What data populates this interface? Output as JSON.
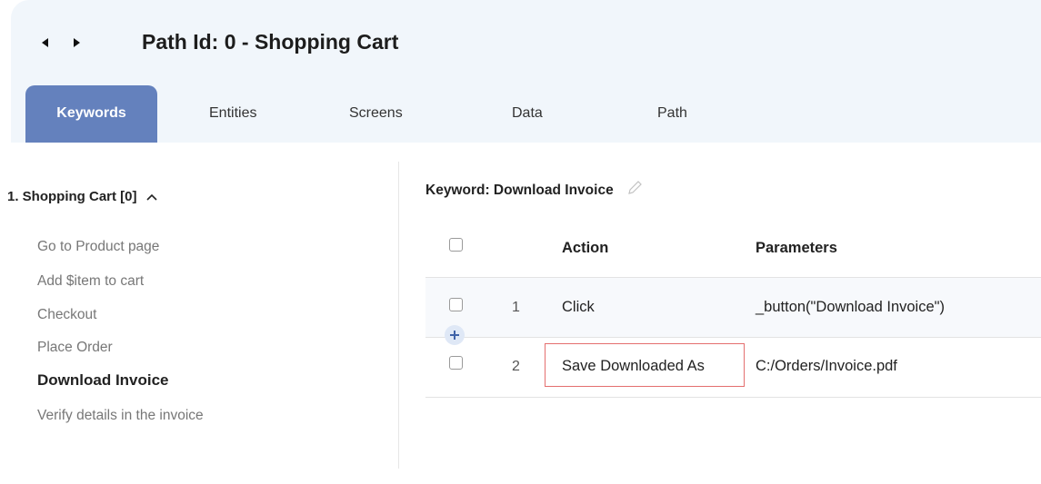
{
  "header": {
    "title": "Path Id: 0 - Shopping Cart",
    "nav": {
      "back_icon": "caret-left-icon",
      "forward_icon": "caret-right-icon"
    }
  },
  "tabs": [
    {
      "label": "Keywords",
      "active": true
    },
    {
      "label": "Entities",
      "active": false
    },
    {
      "label": "Screens",
      "active": false
    },
    {
      "label": "Data",
      "active": false
    },
    {
      "label": "Path",
      "active": false
    }
  ],
  "sidebar": {
    "group_label": "1. Shopping Cart [0]",
    "expanded_icon": "chevron-up-icon",
    "items": [
      {
        "label": "Go to Product page",
        "active": false
      },
      {
        "label": "Add $item to cart",
        "active": false
      },
      {
        "label": "Checkout",
        "active": false
      },
      {
        "label": "Place Order",
        "active": false
      },
      {
        "label": "Download Invoice",
        "active": true
      },
      {
        "label": "Verify details in the invoice",
        "active": false
      }
    ]
  },
  "keyword": {
    "title": "Keyword: Download Invoice",
    "edit_icon": "pencil-icon"
  },
  "table": {
    "columns": {
      "action": "Action",
      "parameters": "Parameters"
    },
    "rows": [
      {
        "num": "1",
        "action": "Click",
        "parameters": "_button(\"Download Invoice\")"
      },
      {
        "num": "2",
        "action": "Save Downloaded As",
        "parameters": "C:/Orders/Invoice.pdf",
        "highlighted": true
      }
    ],
    "insert_icon": "plus-icon"
  },
  "colors": {
    "accent": "#6481bd",
    "header_bg": "#f1f6fb",
    "highlight_border": "#e46f6f"
  }
}
